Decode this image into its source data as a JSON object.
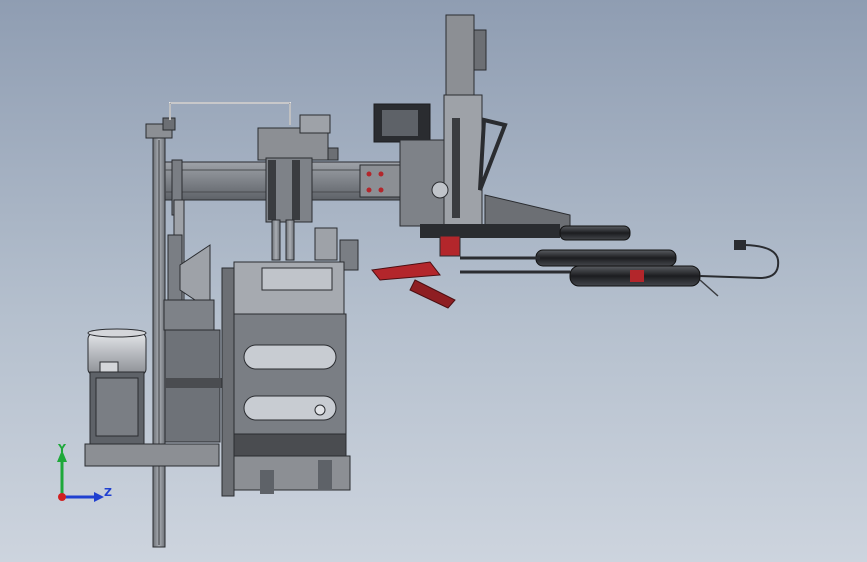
{
  "viewport": {
    "background_top": "#8f9db2",
    "background_bottom": "#cdd4de"
  },
  "model": {
    "description_icon": "cad-assembly-machine",
    "steel_color": "#8c8f94",
    "dark_color": "#2a2c30",
    "accent_red": "#b3262b"
  },
  "triad": {
    "y_label": "Y",
    "z_label": "Z",
    "y_color": "#1ea83a",
    "z_color": "#2040d0",
    "x_color": "#d02020"
  }
}
